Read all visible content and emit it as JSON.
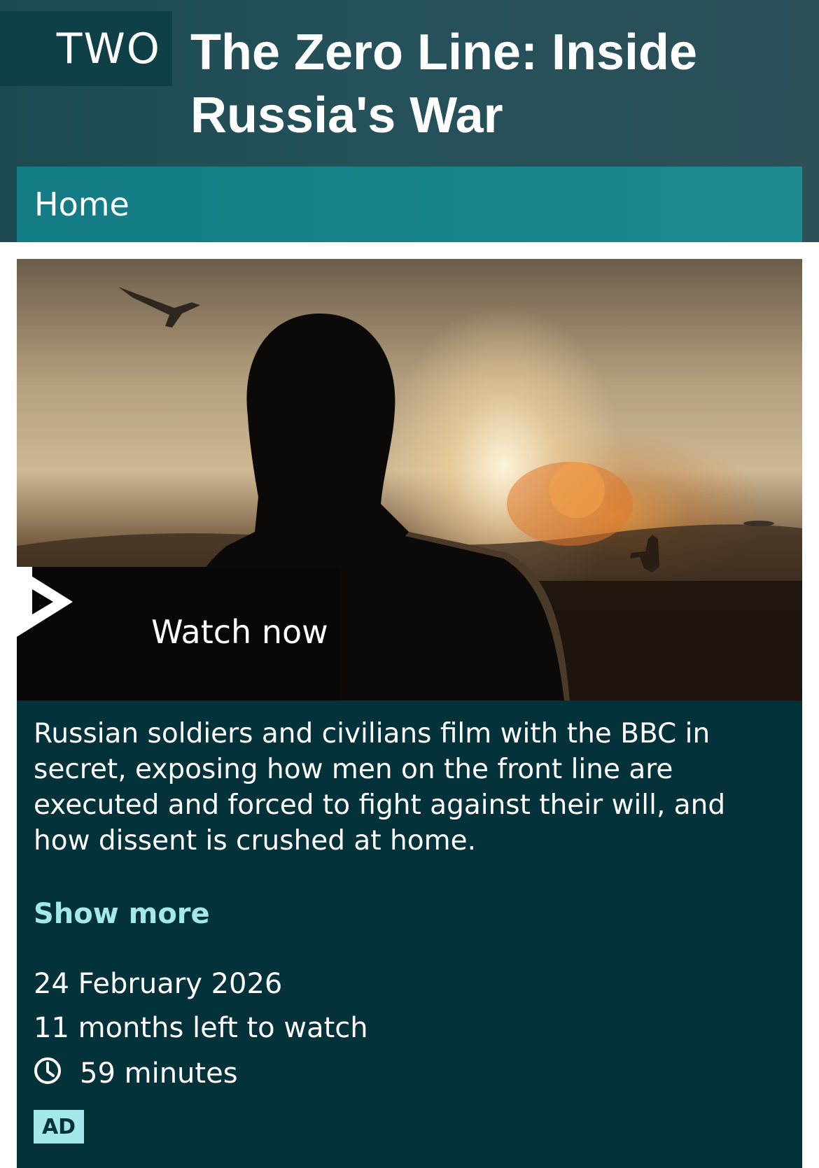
{
  "header": {
    "channel": "TWO",
    "title": "The Zero Line: Inside Russia's War"
  },
  "nav": {
    "home_label": "Home"
  },
  "hero": {
    "watch_label": "Watch now",
    "play_icon": "iplayer-play-icon"
  },
  "episode": {
    "description": "Russian soldiers and civilians film with the BBC in secret, exposing how men on the front line are executed and forced to fight against their will, and how dissent is crushed at home.",
    "show_more_label": "Show more",
    "date": "24 February 2026",
    "availability": "11 months left to watch",
    "duration": "59 minutes",
    "ad_badge": "AD",
    "clock_icon": "clock-icon"
  },
  "colors": {
    "header_bg": "#1d4a52",
    "channel_bg": "#0f3f47",
    "nav_bg": "#178489",
    "info_bg": "#04323a",
    "accent": "#a3e8ea"
  }
}
